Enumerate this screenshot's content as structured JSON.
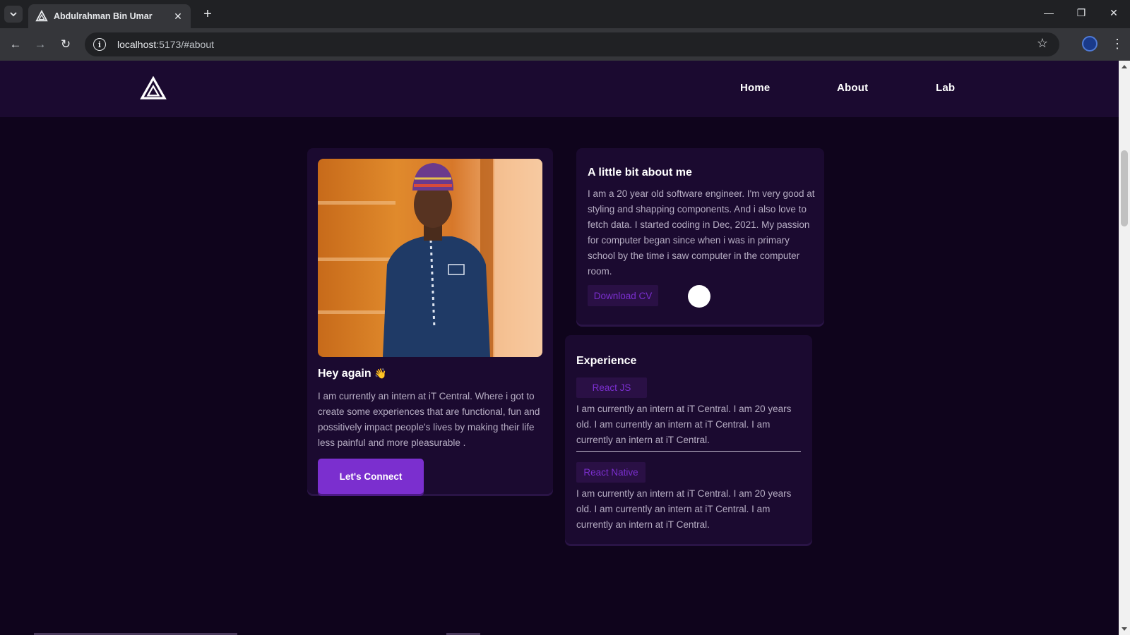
{
  "browser": {
    "tab_title": "Abdulrahman Bin Umar",
    "url_host": "localhost",
    "url_rest": ":5173/#about",
    "tab_menu_icon": "chevron-down-icon",
    "new_tab_icon": "+",
    "close_icon": "✕",
    "minimize_icon": "—",
    "restore_icon": "❐",
    "window_close_icon": "✕",
    "back_icon": "←",
    "forward_icon": "→",
    "reload_icon": "↻",
    "info_icon": "i",
    "star_icon": "☆",
    "menu_icon": "⋮"
  },
  "nav": {
    "links": [
      "Home",
      "About",
      "Lab"
    ]
  },
  "intro": {
    "greeting": "Hey again",
    "wave_emoji": "👋",
    "text": "I am currently an intern at iT Central. Where i got to create some experiences that are functional, fun and possitively impact people's lives by making their life less painful and more pleasurable .",
    "connect_button": "Let's Connect"
  },
  "about": {
    "title": "A little bit about me",
    "text": "I am a 20 year old software engineer. I'm very good at styling and shapping components. And i also love to fetch data. I started coding in Dec, 2021. My passion for computer began since when i was in primary school by the time i saw computer in the computer room.",
    "download_button": "Download CV"
  },
  "experience": {
    "title": "Experience",
    "items": [
      {
        "tag": "React JS",
        "text": "I am currently an intern at iT Central. I am 20 years old. I am currently an intern at iT Central. I am currently an intern at iT Central."
      },
      {
        "tag": "React Native",
        "text": "I am currently an intern at iT Central. I am 20 years old. I am currently an intern at iT Central. I am currently an intern at iT Central."
      }
    ]
  },
  "colors": {
    "page_bg": "#0f041c",
    "card_bg": "#1b0a30",
    "accent": "#7b2fcf",
    "tag_bg": "#2a1045",
    "muted_text": "#b7aec4"
  }
}
